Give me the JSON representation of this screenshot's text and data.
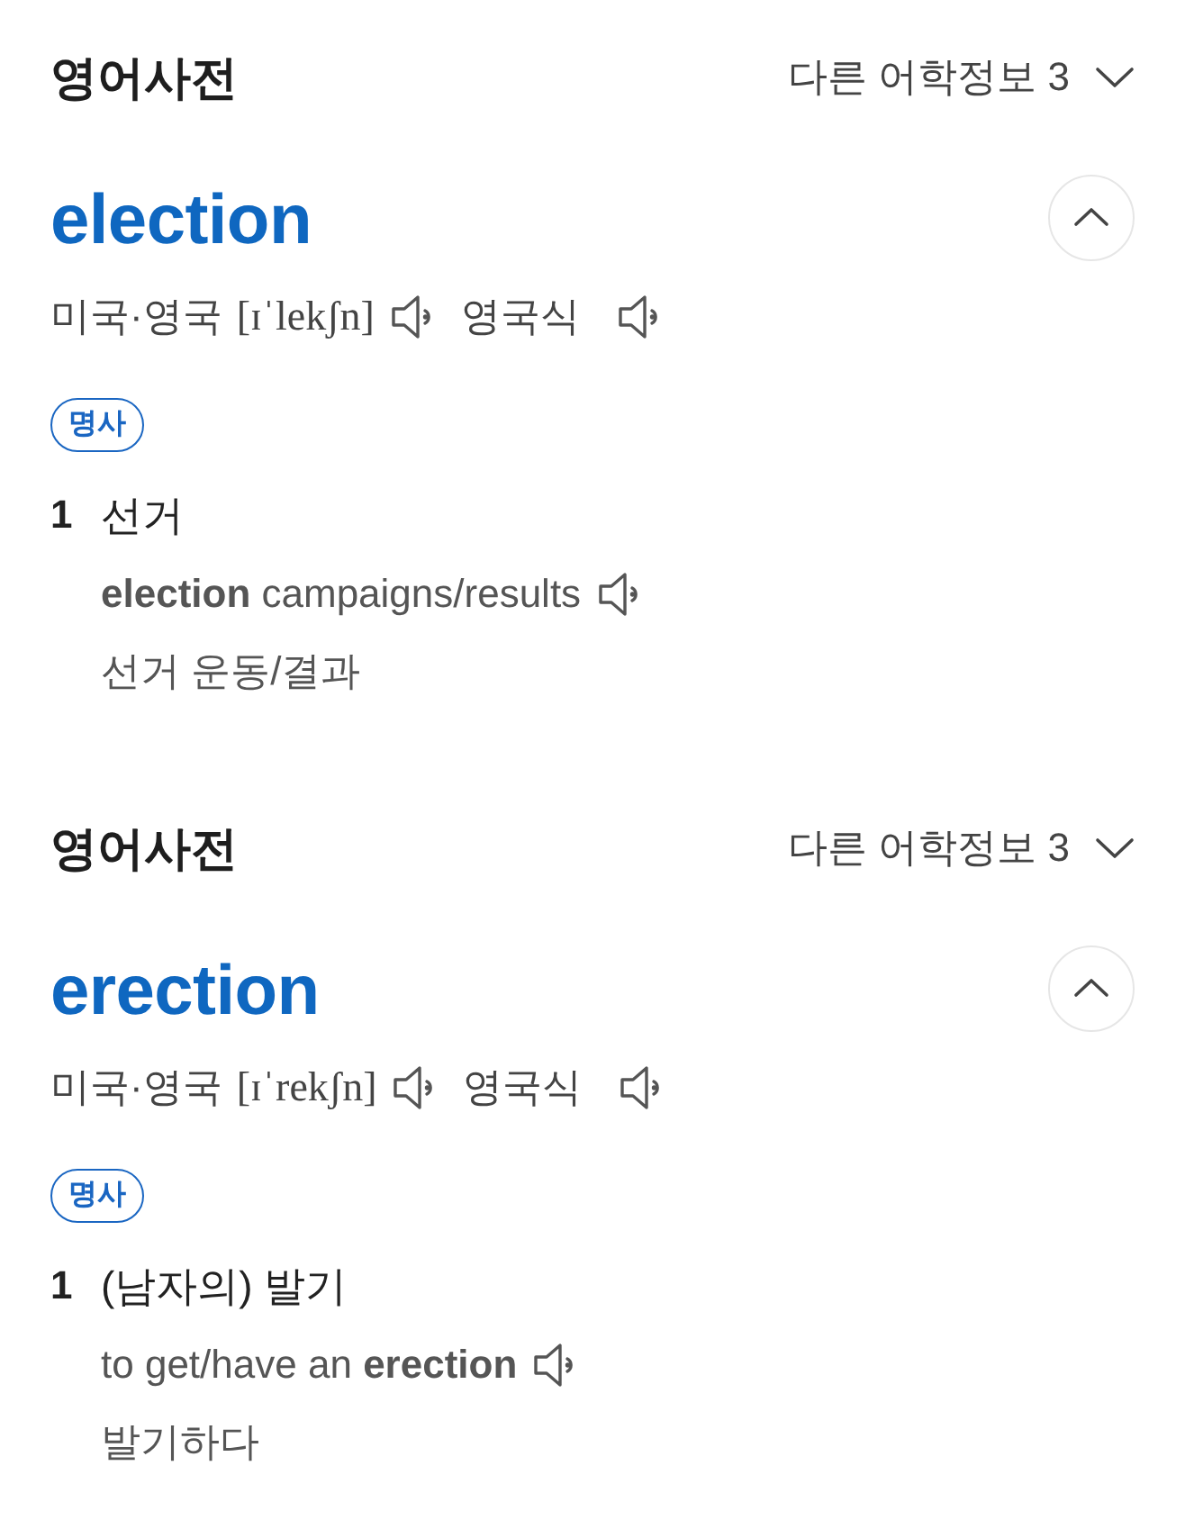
{
  "entries": [
    {
      "dictionary": "영어사전",
      "more_info": "다른 어학정보 3",
      "headword": "election",
      "expanded": true,
      "pronunciations": [
        {
          "label": "미국·영국",
          "ipa": "[ɪˈlekʃn]"
        },
        {
          "label": "영국식"
        }
      ],
      "part_of_speech": "명사",
      "senses": [
        {
          "number": "1",
          "meaning": "선거",
          "examples": [
            {
              "text": "**election** campaigns/results",
              "translation": "선거 운동/결과"
            }
          ]
        }
      ]
    },
    {
      "dictionary": "영어사전",
      "more_info": "다른 어학정보 3",
      "headword": "erection",
      "expanded": true,
      "pronunciations": [
        {
          "label": "미국·영국",
          "ipa": "[ɪˈrekʃn]"
        },
        {
          "label": "영국식"
        }
      ],
      "part_of_speech": "명사",
      "senses": [
        {
          "number": "1",
          "meaning": "(남자의) 발기",
          "examples": [
            {
              "text": "to get/have an **erection**",
              "translation": "발기하다"
            }
          ]
        }
      ]
    }
  ]
}
